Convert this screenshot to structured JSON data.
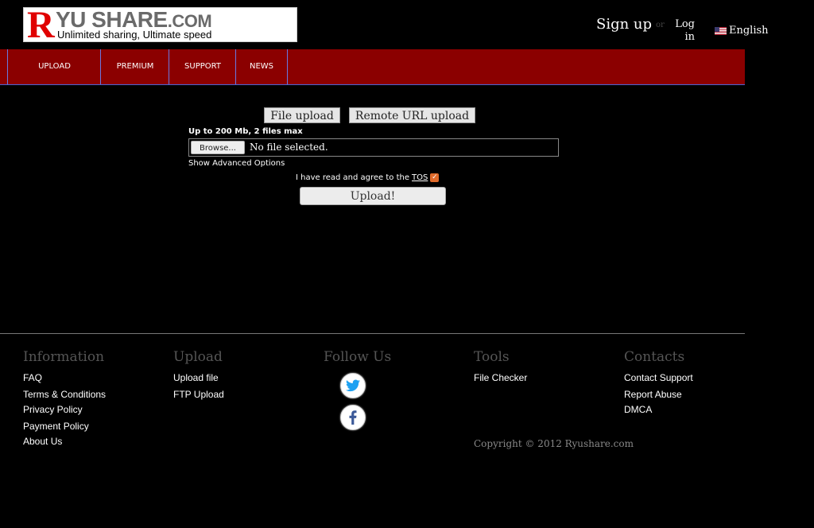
{
  "header": {
    "logo_r": "R",
    "logo_brand": "YU SHARE",
    "logo_dotcom": ".COM",
    "logo_slogan": "Unlimited sharing, Ultimate speed",
    "signup": "Sign up",
    "or": "or",
    "login": "Log in",
    "language": "English"
  },
  "nav": {
    "items": [
      "UPLOAD",
      "PREMIUM",
      "SUPPORT",
      "NEWS"
    ]
  },
  "upload": {
    "tab_file": "File upload",
    "tab_remote": "Remote URL upload",
    "limit": "Up to 200 Mb, 2 files max",
    "browse": "Browse...",
    "no_file": "No file selected.",
    "advanced": "Show Advanced Options",
    "tos_text": "I have read and agree to the",
    "tos_link": "TOS",
    "submit": "Upload!"
  },
  "footer": {
    "information": {
      "title": "Information",
      "links": [
        "FAQ",
        "Terms & Conditions",
        "Privacy Policy",
        "Payment Policy",
        "About Us"
      ]
    },
    "upload": {
      "title": "Upload",
      "links": [
        "Upload file",
        "FTP Upload"
      ]
    },
    "follow": {
      "title": "Follow Us"
    },
    "tools": {
      "title": "Tools",
      "links": [
        "File Checker"
      ]
    },
    "contacts": {
      "title": "Contacts",
      "links": [
        "Contact Support",
        "Report Abuse",
        "DMCA"
      ]
    },
    "copyright": "Copyright © 2012 Ryushare.com"
  },
  "colors": {
    "nav_bg": "#8b0000",
    "twitter": "#1da1f2",
    "facebook": "#3b5998",
    "logo_red": "#e00000"
  }
}
